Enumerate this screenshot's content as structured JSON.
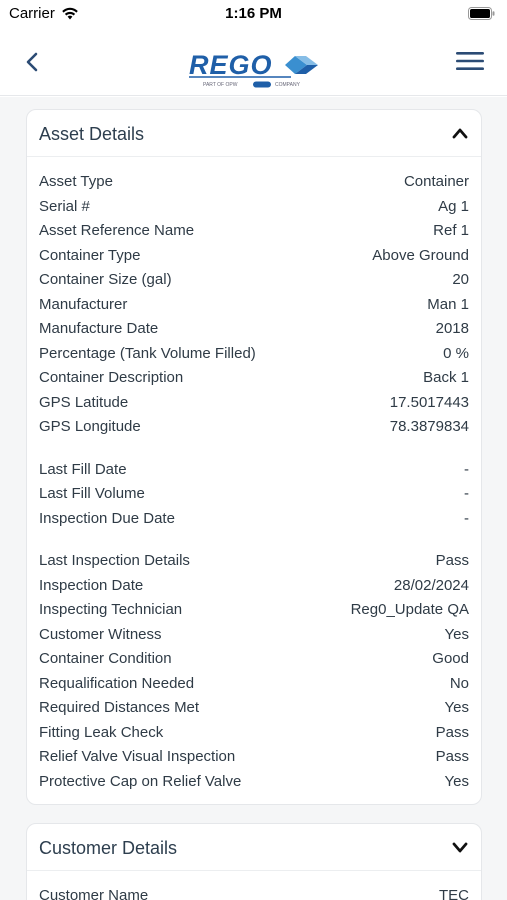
{
  "status_bar": {
    "carrier": "Carrier",
    "time": "1:16 PM"
  },
  "header": {
    "logo_text": "REGO",
    "logo_tagline": "PART OF OPW",
    "logo_company": "COMPANY"
  },
  "asset_details": {
    "title": "Asset Details",
    "rows": [
      {
        "label": "Asset Type",
        "value": "Container"
      },
      {
        "label": "Serial #",
        "value": "Ag 1"
      },
      {
        "label": "Asset Reference Name",
        "value": "Ref 1"
      },
      {
        "label": "Container Type",
        "value": "Above Ground"
      },
      {
        "label": "Container Size (gal)",
        "value": "20"
      },
      {
        "label": "Manufacturer",
        "value": "Man 1"
      },
      {
        "label": "Manufacture Date",
        "value": "2018"
      },
      {
        "label": "Percentage (Tank Volume Filled)",
        "value": "0 %"
      },
      {
        "label": "Container Description",
        "value": "Back 1"
      },
      {
        "label": "GPS Latitude",
        "value": "17.5017443"
      },
      {
        "label": "GPS Longitude",
        "value": "78.3879834"
      },
      {
        "label": "Last Fill Date",
        "value": "-"
      },
      {
        "label": "Last Fill Volume",
        "value": "-"
      },
      {
        "label": "Inspection Due Date",
        "value": "-"
      },
      {
        "label": "Last Inspection Details",
        "value": "Pass"
      },
      {
        "label": "Inspection Date",
        "value": "28/02/2024"
      },
      {
        "label": "Inspecting Technician",
        "value": "Reg0_Update QA"
      },
      {
        "label": "Customer Witness",
        "value": "Yes"
      },
      {
        "label": "Container Condition",
        "value": "Good"
      },
      {
        "label": "Requalification Needed",
        "value": "No"
      },
      {
        "label": "Required Distances Met",
        "value": "Yes"
      },
      {
        "label": "Fitting Leak Check",
        "value": "Pass"
      },
      {
        "label": "Relief Valve Visual Inspection",
        "value": "Pass"
      },
      {
        "label": "Protective Cap on Relief Valve",
        "value": "Yes"
      }
    ]
  },
  "customer_details": {
    "title": "Customer Details",
    "rows": [
      {
        "label": "Customer Name",
        "value": "TEC"
      }
    ]
  },
  "colors": {
    "brand_blue": "#1f5fa8",
    "accent_blue": "#3a8fd0",
    "title_text": "#2d3e4e",
    "background": "#f5f6f7"
  },
  "icons": {
    "back": "chevron-left-icon",
    "menu": "hamburger-menu-icon",
    "asset_toggle": "chevron-up-icon",
    "customer_toggle": "chevron-down-icon",
    "wifi": "wifi-icon",
    "battery": "battery-icon"
  }
}
